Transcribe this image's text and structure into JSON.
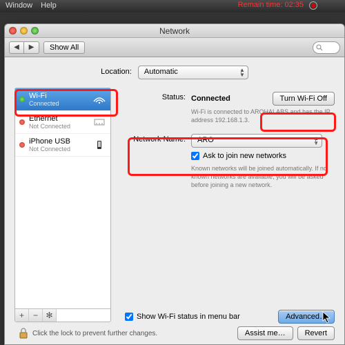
{
  "menubar": {
    "items": [
      "Window",
      "Help"
    ],
    "remain": "Remain time: 02:35"
  },
  "window": {
    "title": "Network",
    "nav": {
      "back": "◀",
      "fwd": "▶",
      "showall": "Show All"
    },
    "location": {
      "label": "Location:",
      "value": "Automatic"
    }
  },
  "sidebar": {
    "items": [
      {
        "name": "Wi-Fi",
        "sub": "Connected",
        "status": "green"
      },
      {
        "name": "Ethernet",
        "sub": "Not Connected",
        "status": "red"
      },
      {
        "name": "iPhone USB",
        "sub": "Not Connected",
        "status": "red"
      }
    ],
    "footer": [
      "+",
      "−",
      "✻"
    ]
  },
  "content": {
    "status_label": "Status:",
    "status_value": "Connected",
    "turnoff": "Turn Wi-Fi Off",
    "status_detail": "Wi-Fi is connected to AROHALABS and has the IP address 192.168.1.3.",
    "netname_label": "Network Name:",
    "netname_value": "ARO",
    "ask_label": "Ask to join new networks",
    "ask_detail": "Known networks will be joined automatically. If no known networks are available, you will be asked before joining a new network.",
    "menubar_check": "Show Wi-Fi status in menu bar",
    "advanced": "Advanced…"
  },
  "lock": {
    "text": "Click the lock to prevent further changes."
  },
  "footer": {
    "assist": "Assist me…",
    "revert": "Revert"
  }
}
